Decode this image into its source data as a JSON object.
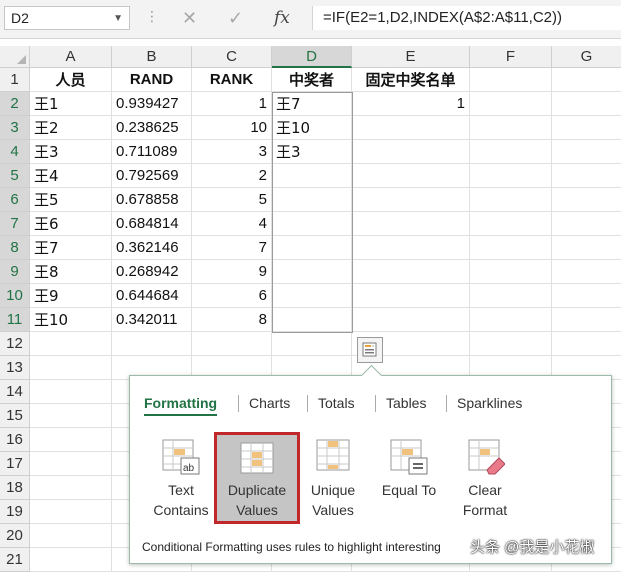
{
  "formula_bar": {
    "name_box": "D2",
    "formula": "=IF(E2=1,D2,INDEX(A$2:A$11,C2))",
    "icons": [
      "cancel-icon",
      "enter-icon",
      "insert-function-icon"
    ],
    "fx_label": "fx"
  },
  "columns": [
    "A",
    "B",
    "C",
    "D",
    "E",
    "F",
    "G"
  ],
  "rows": [
    "1",
    "2",
    "3",
    "4",
    "5",
    "6",
    "7",
    "8",
    "9",
    "10",
    "11",
    "12",
    "13",
    "14",
    "15",
    "16",
    "17",
    "18",
    "19",
    "20",
    "21"
  ],
  "header_row": [
    "人员",
    "RAND",
    "RANK",
    "中奖者",
    "固定中奖名单"
  ],
  "data_rows": [
    {
      "a": "王1",
      "b": "0.939427",
      "c": "1",
      "d": "王7",
      "e": "1"
    },
    {
      "a": "王2",
      "b": "0.238625",
      "c": "10",
      "d": "王10",
      "e": ""
    },
    {
      "a": "王3",
      "b": "0.711089",
      "c": "3",
      "d": "王3",
      "e": ""
    },
    {
      "a": "王4",
      "b": "0.792569",
      "c": "2",
      "d": "",
      "e": ""
    },
    {
      "a": "王5",
      "b": "0.678858",
      "c": "5",
      "d": "",
      "e": ""
    },
    {
      "a": "王6",
      "b": "0.684814",
      "c": "4",
      "d": "",
      "e": ""
    },
    {
      "a": "王7",
      "b": "0.362146",
      "c": "7",
      "d": "",
      "e": ""
    },
    {
      "a": "王8",
      "b": "0.268942",
      "c": "9",
      "d": "",
      "e": ""
    },
    {
      "a": "王9",
      "b": "0.644684",
      "c": "6",
      "d": "",
      "e": ""
    },
    {
      "a": "王10",
      "b": "0.342011",
      "c": "8",
      "d": "",
      "e": ""
    }
  ],
  "quick_analysis": {
    "tabs": [
      "Formatting",
      "Charts",
      "Totals",
      "Tables",
      "Sparklines"
    ],
    "active_tab": "Formatting",
    "options": [
      {
        "line1": "Text",
        "line2": "Contains",
        "icon": "text-contains-icon"
      },
      {
        "line1": "Duplicate",
        "line2": "Values",
        "icon": "duplicate-values-icon"
      },
      {
        "line1": "Unique",
        "line2": "Values",
        "icon": "unique-values-icon"
      },
      {
        "line1": "Equal To",
        "line2": "",
        "icon": "equal-to-icon"
      },
      {
        "line1": "Clear",
        "line2": "Format",
        "icon": "clear-format-icon"
      }
    ],
    "selected_option": "Duplicate Values",
    "description": "Conditional Formatting uses rules to highlight interesting"
  },
  "colors": {
    "excel_green": "#217346",
    "highlight_border": "#c0282b",
    "selected_bg": "#c5c5c5"
  },
  "watermark": "头条 @我是小花椒"
}
